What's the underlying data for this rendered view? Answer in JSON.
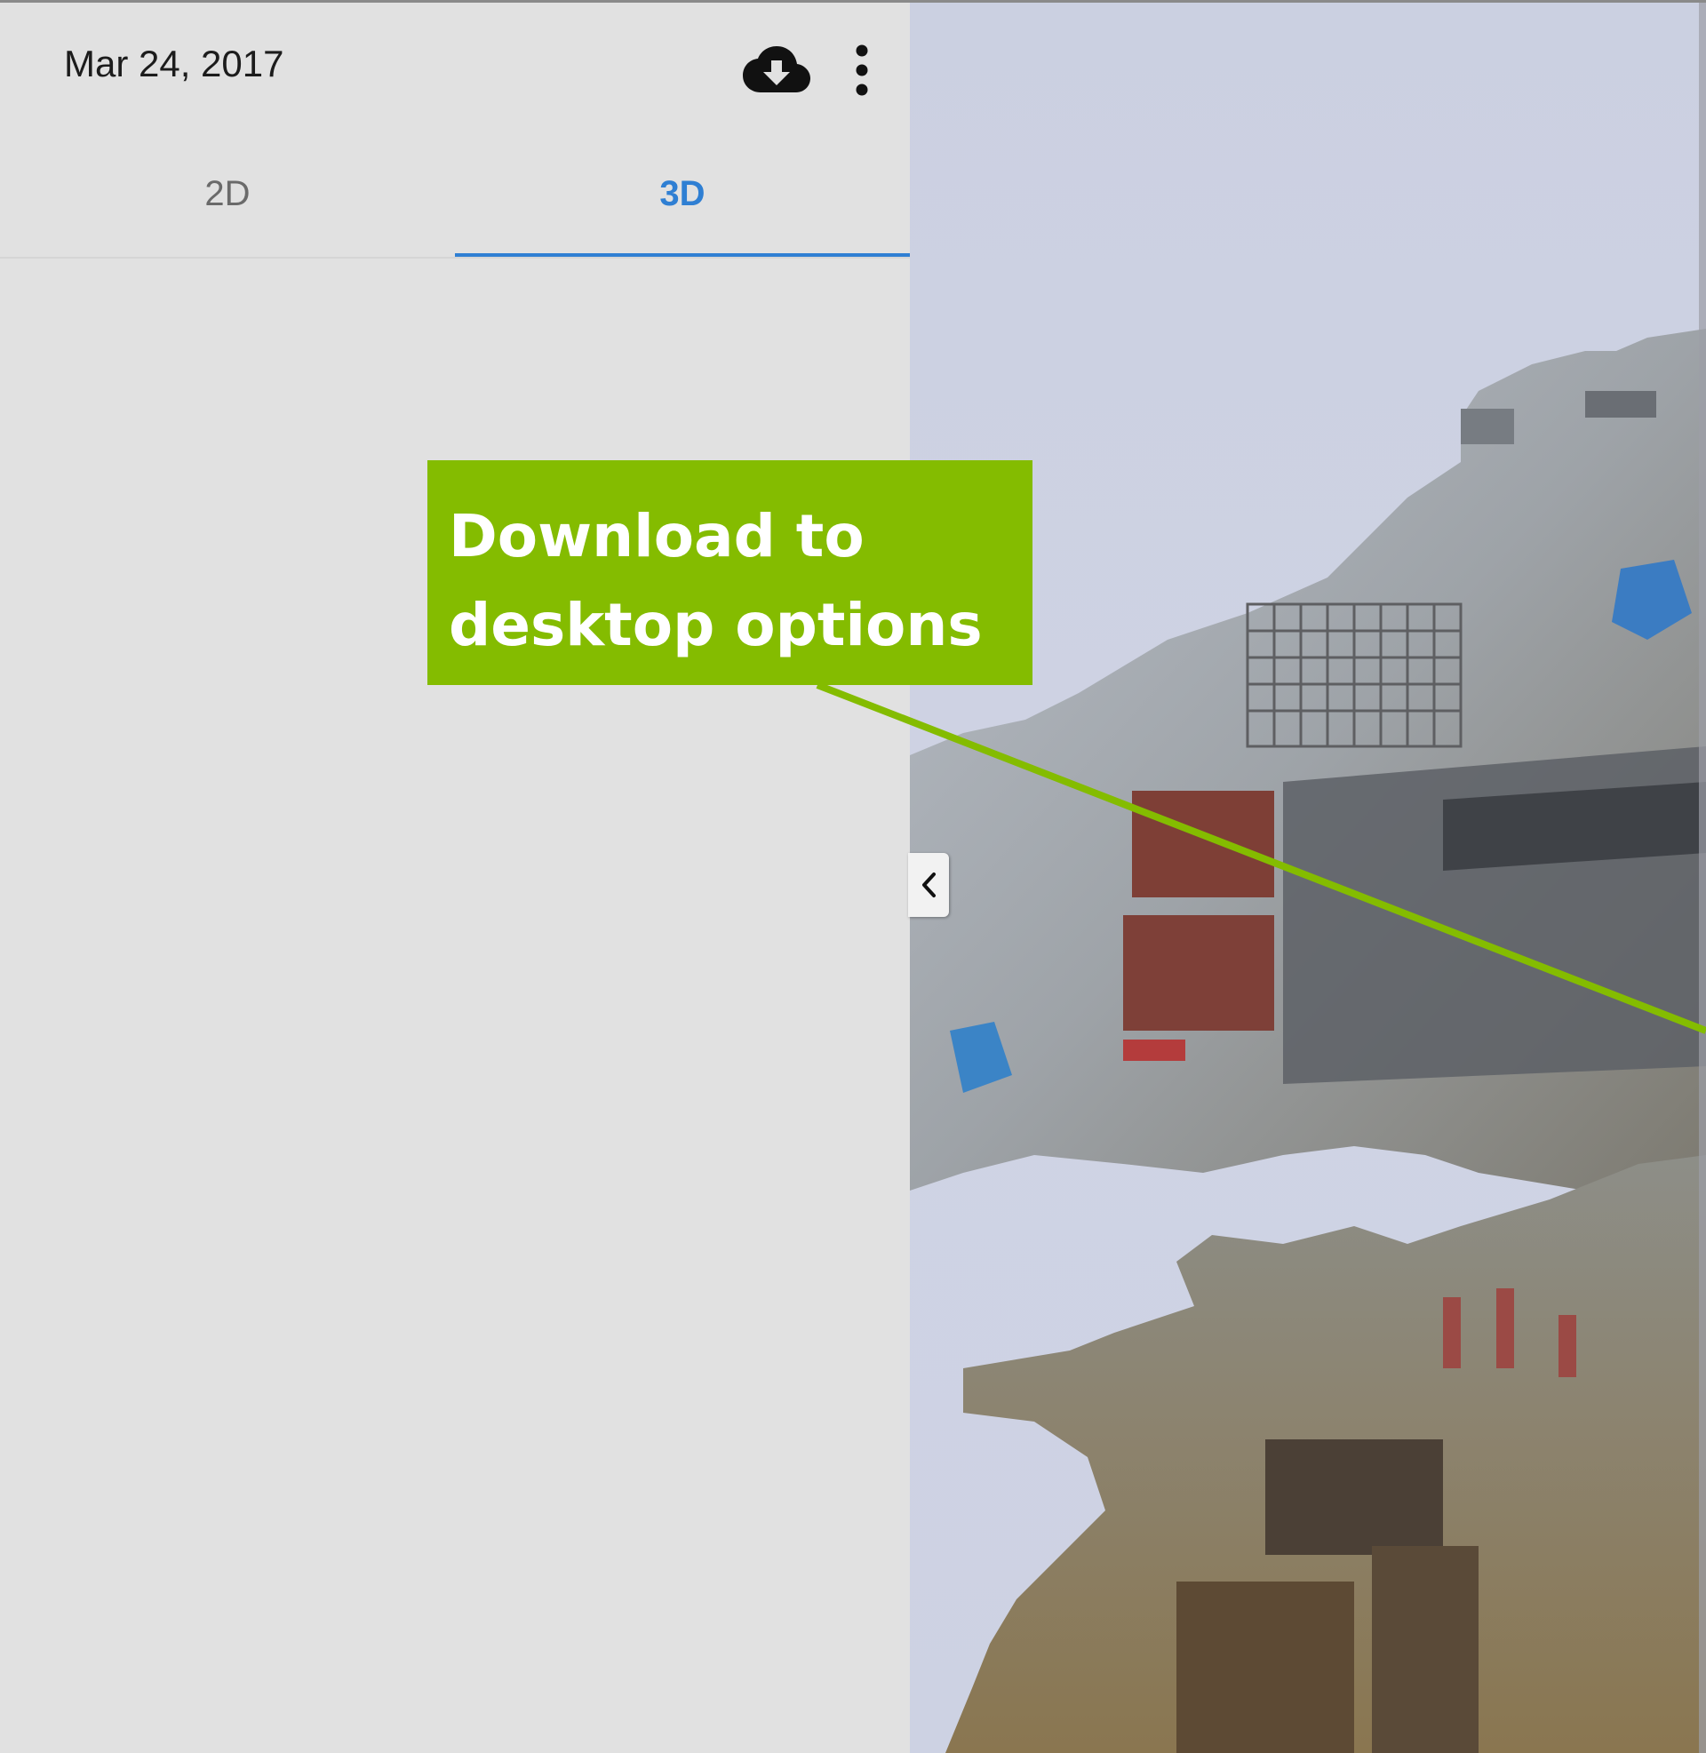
{
  "header": {
    "date": "Mar 24, 2017",
    "download_icon": "cloud-download-icon",
    "more_icon": "more-vert-icon"
  },
  "tabs": [
    {
      "label": "2D",
      "selected": false
    },
    {
      "label": "3D",
      "selected": true
    }
  ],
  "colors": {
    "accent": "#2f7fd3",
    "callout": "#84bc00",
    "panel_bg": "#e1e1e1",
    "viewport_bg": "#cdd2e3"
  },
  "viewer": {
    "collapse_icon": "chevron-left-icon"
  },
  "annotation": {
    "text": "Download to\ndesktop options"
  }
}
